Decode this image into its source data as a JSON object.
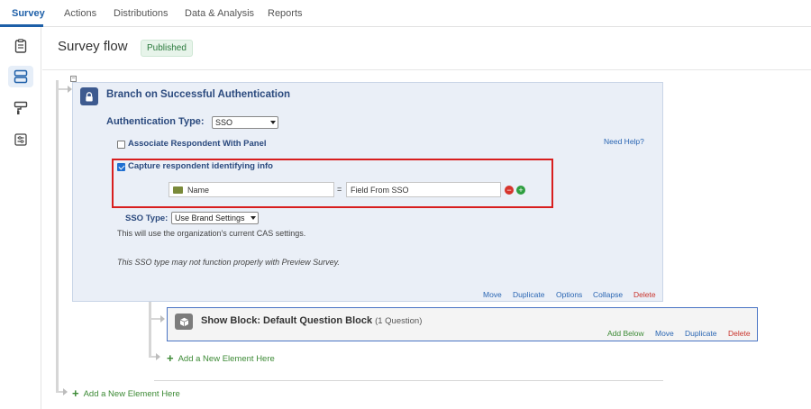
{
  "nav": {
    "tabs": [
      {
        "label": "Survey"
      },
      {
        "label": "Actions"
      },
      {
        "label": "Distributions"
      },
      {
        "label": "Data & Analysis"
      },
      {
        "label": "Reports"
      }
    ]
  },
  "sidebar": {
    "icons": [
      "survey-editor-icon",
      "survey-flow-icon",
      "look-and-feel-icon",
      "survey-options-icon"
    ]
  },
  "header": {
    "title": "Survey flow",
    "status": "Published"
  },
  "auth_panel": {
    "title": "Branch on Successful Authentication",
    "auth_type_label": "Authentication Type:",
    "auth_type_value": "SSO",
    "associate_label": "Associate Respondent With Panel",
    "associate_checked": false,
    "need_help": "Need Help?",
    "capture_label": "Capture respondent identifying info",
    "capture_checked": true,
    "field_name": "Name",
    "equals": "=",
    "field_value": "Field From SSO",
    "sso_type_label": "SSO Type:",
    "sso_type_value": "Use Brand Settings",
    "info_cas": "This will use the organization's current CAS settings.",
    "info_preview": "This SSO type may not function properly with Preview Survey.",
    "actions": {
      "move": "Move",
      "duplicate": "Duplicate",
      "options": "Options",
      "collapse": "Collapse",
      "delete": "Delete"
    }
  },
  "block_panel": {
    "title": "Show Block: Default Question Block",
    "subtitle": "(1 Question)",
    "actions": {
      "add_below": "Add Below",
      "move": "Move",
      "duplicate": "Duplicate",
      "delete": "Delete"
    }
  },
  "add_element_inner": "Add a New Element Here",
  "add_element_outer": "Add a New Element Here",
  "colors": {
    "accent": "#1d5fa8",
    "auth_bg": "#eaeff7",
    "highlight": "#d81e1e",
    "delete": "#c9342c",
    "add_green": "#3c8a35"
  }
}
